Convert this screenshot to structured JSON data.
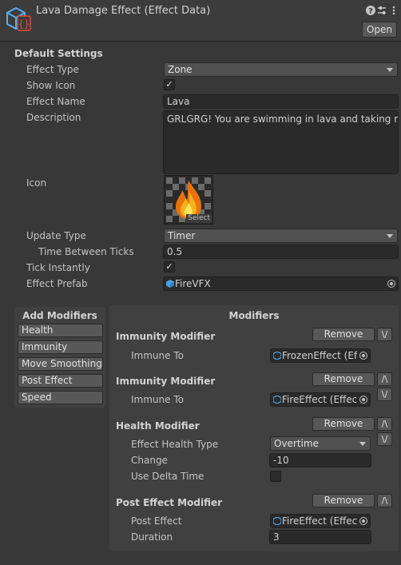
{
  "header": {
    "title": "Lava Damage Effect (Effect Data)",
    "open_label": "Open"
  },
  "default_settings": {
    "title": "Default Settings",
    "effect_type": {
      "label": "Effect Type",
      "value": "Zone"
    },
    "show_icon": {
      "label": "Show Icon",
      "checked": true
    },
    "effect_name": {
      "label": "Effect Name",
      "value": "Lava"
    },
    "description": {
      "label": "Description",
      "value": "GRLGRG! You are swimming in lava and taking majo"
    },
    "icon": {
      "label": "Icon",
      "select_label": "Select"
    },
    "update_type": {
      "label": "Update Type",
      "value": "Timer"
    },
    "time_between_ticks": {
      "label": "Time Between Ticks",
      "value": "0.5"
    },
    "tick_instantly": {
      "label": "Tick Instantly",
      "checked": true
    },
    "effect_prefab": {
      "label": "Effect Prefab",
      "value": "FireVFX"
    }
  },
  "add_modifiers": {
    "title": "Add Modifiers",
    "buttons": [
      "Health",
      "Immunity",
      "Move Smoothing",
      "Post Effect",
      "Speed"
    ]
  },
  "modifiers": {
    "title": "Modifiers",
    "remove_label": "Remove",
    "up_label": "/\\",
    "down_label": "\\/",
    "items": [
      {
        "title": "Immunity Modifier",
        "fields": [
          {
            "label": "Immune To",
            "value": "FrozenEffect (Eff"
          }
        ]
      },
      {
        "title": "Immunity Modifier",
        "fields": [
          {
            "label": "Immune To",
            "value": "FireEffect (Effect"
          }
        ]
      },
      {
        "title": "Health Modifier",
        "fields": [
          {
            "label": "Effect Health Type",
            "value": "Overtime"
          },
          {
            "label": "Change",
            "value": "-10"
          },
          {
            "label": "Use Delta Time",
            "checked": false
          }
        ]
      },
      {
        "title": "Post Effect Modifier",
        "fields": [
          {
            "label": "Post Effect",
            "value": "FireEffect (Effect"
          },
          {
            "label": "Duration",
            "value": "3"
          }
        ]
      }
    ]
  },
  "icons": {
    "header": "scriptable-object-cube-icon",
    "help": "help-icon",
    "settings": "settings-sliders-icon",
    "menu": "kebab-menu-icon",
    "object": "prefab-cube-icon",
    "picker": "object-picker-icon",
    "fire": "fire-sprite-icon"
  },
  "colors": {
    "background": "#383838",
    "field": "#2a2a2a",
    "button": "#585858",
    "accent": "#46a0e6",
    "fire": "#f08a16"
  }
}
